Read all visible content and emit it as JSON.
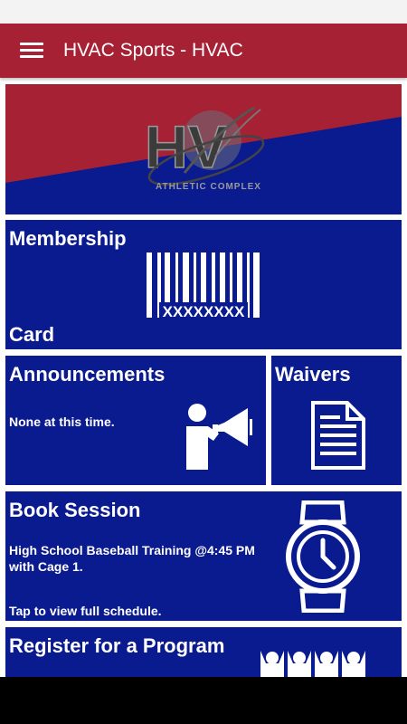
{
  "app_bar": {
    "title": "HVAC Sports - HVAC",
    "menu_icon": "hamburger-menu-icon"
  },
  "banner": {
    "logo_text": "HV",
    "logo_subtext": "ATHLETIC COMPLEX",
    "colors": {
      "top": "#a62134",
      "bottom": "#0a1a8f"
    }
  },
  "membership": {
    "title_line1": "Membership",
    "title_line2": "Card",
    "barcode_number": "XXXXXXXX",
    "icon": "barcode-icon"
  },
  "announcements": {
    "title": "Announcements",
    "text": "None at this time.",
    "icon": "megaphone-icon"
  },
  "waivers": {
    "title": "Waivers",
    "icon": "document-icon"
  },
  "book_session": {
    "title": "Book Session",
    "session_line1": "High School Baseball Training @4:45 PM",
    "session_line2": "with Cage 1.",
    "footer": "Tap to view full schedule.",
    "icon": "watch-icon"
  },
  "register": {
    "title": "Register for a Program",
    "icon": "group-icon"
  },
  "colors": {
    "app_bar": "#a62134",
    "tile": "#0a1a8f",
    "text": "#ffffff"
  }
}
